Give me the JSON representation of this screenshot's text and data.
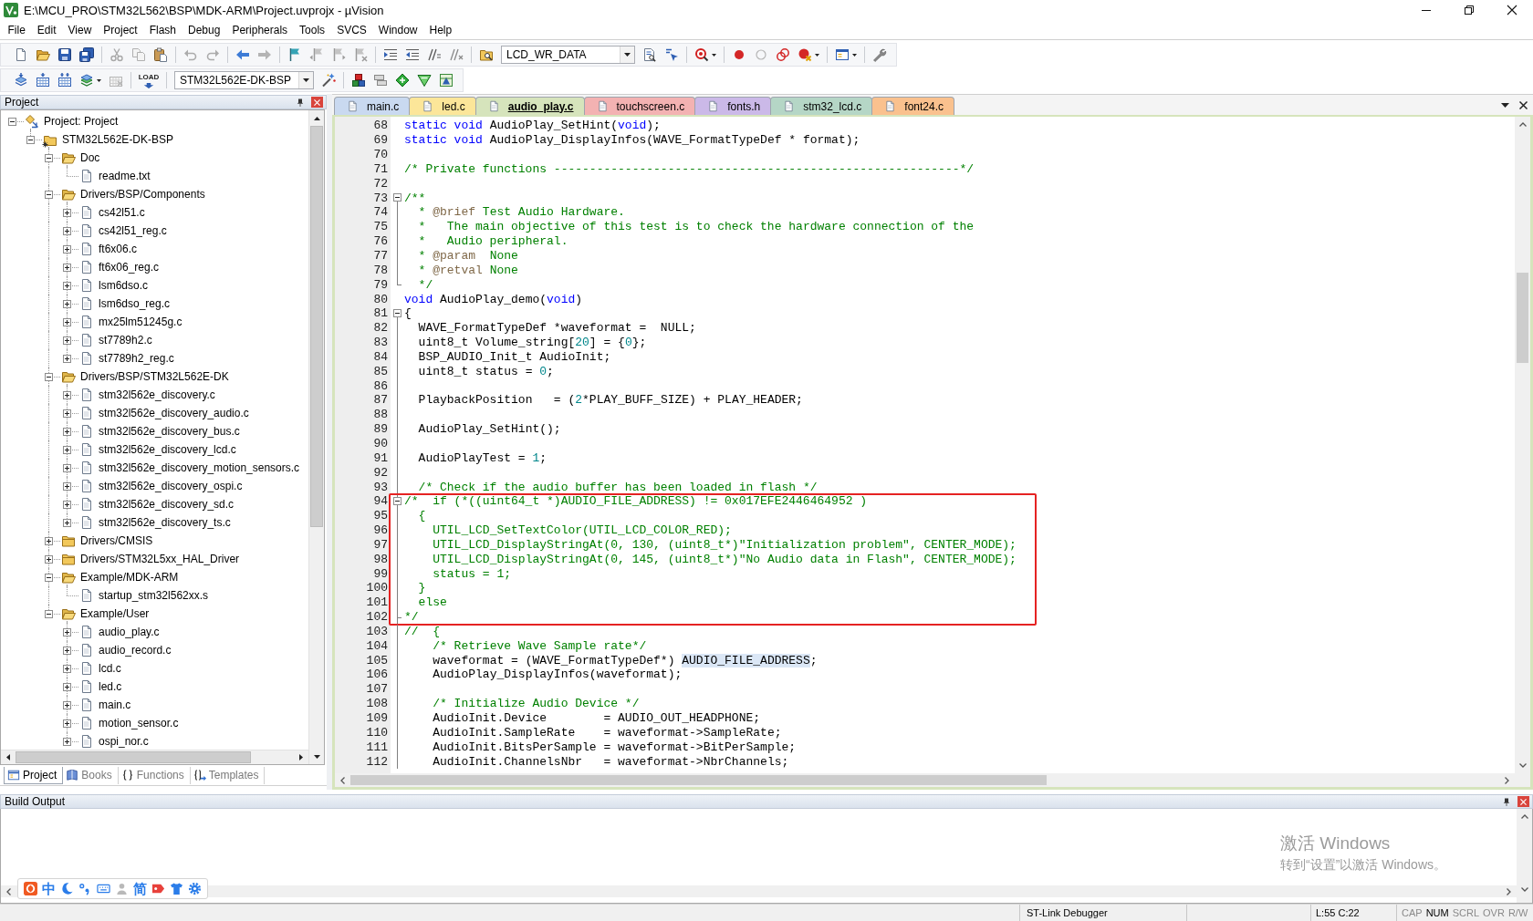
{
  "window": {
    "title": "E:\\MCU_PRO\\STM32L562\\BSP\\MDK-ARM\\Project.uvprojx - µVision"
  },
  "menu": [
    "File",
    "Edit",
    "View",
    "Project",
    "Flash",
    "Debug",
    "Peripherals",
    "Tools",
    "SVCS",
    "Window",
    "Help"
  ],
  "toolbar": {
    "find_text": "LCD_WR_DATA",
    "load_caption": "LOAD",
    "target": "STM32L562E-DK-BSP"
  },
  "project_panel": {
    "title": "Project",
    "tree": [
      {
        "label": "Project: Project",
        "kind": "project",
        "expanded": true,
        "children": [
          {
            "label": "STM32L562E-DK-BSP",
            "kind": "target",
            "expanded": true,
            "children": [
              {
                "label": "Doc",
                "kind": "group",
                "expanded": true,
                "children": [
                  {
                    "label": "readme.txt",
                    "kind": "file"
                  }
                ]
              },
              {
                "label": "Drivers/BSP/Components",
                "kind": "group",
                "expanded": true,
                "children": [
                  {
                    "label": "cs42l51.c",
                    "kind": "file",
                    "expanded": false
                  },
                  {
                    "label": "cs42l51_reg.c",
                    "kind": "file",
                    "expanded": false
                  },
                  {
                    "label": "ft6x06.c",
                    "kind": "file",
                    "expanded": false
                  },
                  {
                    "label": "ft6x06_reg.c",
                    "kind": "file",
                    "expanded": false
                  },
                  {
                    "label": "lsm6dso.c",
                    "kind": "file",
                    "expanded": false
                  },
                  {
                    "label": "lsm6dso_reg.c",
                    "kind": "file",
                    "expanded": false
                  },
                  {
                    "label": "mx25lm51245g.c",
                    "kind": "file",
                    "expanded": false
                  },
                  {
                    "label": "st7789h2.c",
                    "kind": "file",
                    "expanded": false
                  },
                  {
                    "label": "st7789h2_reg.c",
                    "kind": "file",
                    "expanded": false
                  }
                ]
              },
              {
                "label": "Drivers/BSP/STM32L562E-DK",
                "kind": "group",
                "expanded": true,
                "children": [
                  {
                    "label": "stm32l562e_discovery.c",
                    "kind": "file",
                    "expanded": false
                  },
                  {
                    "label": "stm32l562e_discovery_audio.c",
                    "kind": "file",
                    "expanded": false
                  },
                  {
                    "label": "stm32l562e_discovery_bus.c",
                    "kind": "file",
                    "expanded": false
                  },
                  {
                    "label": "stm32l562e_discovery_lcd.c",
                    "kind": "file",
                    "expanded": false
                  },
                  {
                    "label": "stm32l562e_discovery_motion_sensors.c",
                    "kind": "file",
                    "expanded": false
                  },
                  {
                    "label": "stm32l562e_discovery_ospi.c",
                    "kind": "file",
                    "expanded": false
                  },
                  {
                    "label": "stm32l562e_discovery_sd.c",
                    "kind": "file",
                    "expanded": false
                  },
                  {
                    "label": "stm32l562e_discovery_ts.c",
                    "kind": "file",
                    "expanded": false
                  }
                ]
              },
              {
                "label": "Drivers/CMSIS",
                "kind": "group",
                "expanded": false
              },
              {
                "label": "Drivers/STM32L5xx_HAL_Driver",
                "kind": "group",
                "expanded": false
              },
              {
                "label": "Example/MDK-ARM",
                "kind": "group",
                "expanded": true,
                "children": [
                  {
                    "label": "startup_stm32l562xx.s",
                    "kind": "file"
                  }
                ]
              },
              {
                "label": "Example/User",
                "kind": "group",
                "expanded": true,
                "children": [
                  {
                    "label": "audio_play.c",
                    "kind": "file",
                    "expanded": false
                  },
                  {
                    "label": "audio_record.c",
                    "kind": "file",
                    "expanded": false
                  },
                  {
                    "label": "lcd.c",
                    "kind": "file",
                    "expanded": false
                  },
                  {
                    "label": "led.c",
                    "kind": "file",
                    "expanded": false
                  },
                  {
                    "label": "main.c",
                    "kind": "file",
                    "expanded": false
                  },
                  {
                    "label": "motion_sensor.c",
                    "kind": "file",
                    "expanded": false
                  },
                  {
                    "label": "ospi_nor.c",
                    "kind": "file",
                    "expanded": false
                  }
                ]
              }
            ]
          }
        ]
      }
    ],
    "tabs": [
      {
        "label": "Project",
        "selected": true
      },
      {
        "label": "Books",
        "selected": false
      },
      {
        "label": "Functions",
        "selected": false
      },
      {
        "label": "Templates",
        "selected": false
      }
    ]
  },
  "editor": {
    "tabs": [
      {
        "label": "main.c",
        "color": "#c9d9f0",
        "selected": false
      },
      {
        "label": "led.c",
        "color": "#fce699",
        "selected": false
      },
      {
        "label": "audio_play.c",
        "color": "#d6e4bc",
        "selected": true
      },
      {
        "label": "touchscreen.c",
        "color": "#f3b2b2",
        "selected": false
      },
      {
        "label": "fonts.h",
        "color": "#cbb9e8",
        "selected": false
      },
      {
        "label": "stm32_lcd.c",
        "color": "#b5d6c6",
        "selected": false
      },
      {
        "label": "font24.c",
        "color": "#fac18e",
        "selected": false
      }
    ],
    "blocks": [
      {
        "boxed": false,
        "lines": [
          {
            "number": "68",
            "kind": "plain",
            "code": [
              {
                "kind": "keyword",
                "text": "static void"
              },
              {
                "kind": "plain",
                "text": " AudioPlay_SetHint("
              },
              {
                "kind": "keyword",
                "text": "void"
              },
              {
                "kind": "plain",
                "text": ");"
              }
            ]
          },
          {
            "number": "69",
            "kind": "plain",
            "code": [
              {
                "kind": "keyword",
                "text": "static void"
              },
              {
                "kind": "plain",
                "text": " AudioPlay_DisplayInfos(WAVE_FormatTypeDef * format);"
              }
            ]
          },
          {
            "number": "70",
            "kind": "plain"
          },
          {
            "number": "71",
            "kind": "plain",
            "code": [
              {
                "kind": "comment",
                "text": "/* Private functions ---------------------------------------------------------*/"
              }
            ]
          },
          {
            "number": "72",
            "kind": "plain"
          },
          {
            "number": "73",
            "kind": "fold_start",
            "code": [
              {
                "kind": "comment",
                "text": "/**"
              }
            ]
          },
          {
            "number": "74",
            "kind": "fold_body",
            "code": [
              {
                "kind": "comment",
                "text": "  * "
              },
              {
                "kind": "doctag",
                "text": "@brief"
              },
              {
                "kind": "comment",
                "text": " Test Audio Hardware."
              }
            ]
          },
          {
            "number": "75",
            "kind": "fold_body",
            "code": [
              {
                "kind": "comment",
                "text": "  *   The main objective of this test is to check the hardware connection of the"
              }
            ]
          },
          {
            "number": "76",
            "kind": "fold_body",
            "code": [
              {
                "kind": "comment",
                "text": "  *   Audio peripheral."
              }
            ]
          },
          {
            "number": "77",
            "kind": "fold_body",
            "code": [
              {
                "kind": "comment",
                "text": "  * "
              },
              {
                "kind": "doctag",
                "text": "@param"
              },
              {
                "kind": "comment",
                "text": "  None"
              }
            ]
          },
          {
            "number": "78",
            "kind": "fold_body",
            "code": [
              {
                "kind": "comment",
                "text": "  * "
              },
              {
                "kind": "doctag",
                "text": "@retval"
              },
              {
                "kind": "comment",
                "text": " None"
              }
            ]
          },
          {
            "number": "79",
            "kind": "fold_end",
            "code": [
              {
                "kind": "comment",
                "text": "  */"
              }
            ]
          },
          {
            "number": "80",
            "kind": "plain",
            "code": [
              {
                "kind": "keyword",
                "text": "void"
              },
              {
                "kind": "plain",
                "text": " AudioPlay_demo("
              },
              {
                "kind": "keyword",
                "text": "void"
              },
              {
                "kind": "plain",
                "text": ")"
              }
            ]
          },
          {
            "number": "81",
            "kind": "fold_start",
            "code": [
              {
                "kind": "plain",
                "text": "{"
              }
            ]
          },
          {
            "number": "82",
            "kind": "fold_body",
            "code": [
              {
                "kind": "plain",
                "text": "  WAVE_FormatTypeDef *waveformat =  NULL;"
              }
            ]
          },
          {
            "number": "83",
            "kind": "fold_body",
            "code": [
              {
                "kind": "plain",
                "text": "  uint8_t Volume_string["
              },
              {
                "kind": "number",
                "text": "20"
              },
              {
                "kind": "plain",
                "text": "] = {"
              },
              {
                "kind": "number",
                "text": "0"
              },
              {
                "kind": "plain",
                "text": "};"
              }
            ]
          },
          {
            "number": "84",
            "kind": "fold_body",
            "code": [
              {
                "kind": "plain",
                "text": "  BSP_AUDIO_Init_t AudioInit;"
              }
            ]
          },
          {
            "number": "85",
            "kind": "fold_body",
            "code": [
              {
                "kind": "plain",
                "text": "  uint8_t status = "
              },
              {
                "kind": "number",
                "text": "0"
              },
              {
                "kind": "plain",
                "text": ";"
              }
            ]
          },
          {
            "number": "86",
            "kind": "fold_body"
          },
          {
            "number": "87",
            "kind": "fold_body",
            "code": [
              {
                "kind": "plain",
                "text": "  PlaybackPosition   = ("
              },
              {
                "kind": "number",
                "text": "2"
              },
              {
                "kind": "plain",
                "text": "*PLAY_BUFF_SIZE) + PLAY_HEADER;"
              }
            ]
          },
          {
            "number": "88",
            "kind": "fold_body"
          },
          {
            "number": "89",
            "kind": "fold_body",
            "code": [
              {
                "kind": "plain",
                "text": "  AudioPlay_SetHint();"
              }
            ]
          },
          {
            "number": "90",
            "kind": "fold_body"
          },
          {
            "number": "91",
            "kind": "fold_body",
            "code": [
              {
                "kind": "plain",
                "text": "  AudioPlayTest = "
              },
              {
                "kind": "number",
                "text": "1"
              },
              {
                "kind": "plain",
                "text": ";"
              }
            ]
          },
          {
            "number": "92",
            "kind": "fold_body"
          },
          {
            "number": "93",
            "kind": "fold_body",
            "code": [
              {
                "kind": "comment",
                "text": "  /* Check if the audio buffer has been loaded in flash */"
              }
            ]
          }
        ]
      },
      {
        "boxed": true,
        "lines": [
          {
            "number": "94",
            "kind": "fold_start",
            "code": [
              {
                "kind": "comment",
                "text": "/*  if (*((uint64_t *)AUDIO_FILE_ADDRESS) != 0x017EFE2446464952 )"
              }
            ]
          },
          {
            "number": "95",
            "kind": "fold_body",
            "code": [
              {
                "kind": "comment",
                "text": "  {"
              }
            ]
          },
          {
            "number": "96",
            "kind": "fold_body",
            "code": [
              {
                "kind": "comment",
                "text": "    UTIL_LCD_SetTextColor(UTIL_LCD_COLOR_RED);"
              }
            ]
          },
          {
            "number": "97",
            "kind": "fold_body",
            "code": [
              {
                "kind": "comment",
                "text": "    UTIL_LCD_DisplayStringAt(0, 130, (uint8_t*)\"Initialization problem\", CENTER_MODE);"
              }
            ]
          },
          {
            "number": "98",
            "kind": "fold_body",
            "code": [
              {
                "kind": "comment",
                "text": "    UTIL_LCD_DisplayStringAt(0, 145, (uint8_t*)\"No Audio data in Flash\", CENTER_MODE);"
              }
            ]
          },
          {
            "number": "99",
            "kind": "fold_body",
            "code": [
              {
                "kind": "comment",
                "text": "    status = 1;"
              }
            ]
          },
          {
            "number": "100",
            "kind": "fold_body",
            "code": [
              {
                "kind": "comment",
                "text": "  }"
              }
            ]
          },
          {
            "number": "101",
            "kind": "fold_body",
            "code": [
              {
                "kind": "comment",
                "text": "  else"
              }
            ]
          },
          {
            "number": "102",
            "kind": "fold_end",
            "code": [
              {
                "kind": "comment",
                "text": "*/"
              }
            ]
          }
        ]
      },
      {
        "boxed": false,
        "lines": [
          {
            "number": "103",
            "kind": "fold_body",
            "code": [
              {
                "kind": "comment",
                "text": "//  {"
              }
            ]
          },
          {
            "number": "104",
            "kind": "fold_body",
            "code": [
              {
                "kind": "comment",
                "text": "    /* Retrieve Wave Sample rate*/"
              }
            ]
          },
          {
            "number": "105",
            "kind": "fold_body",
            "code": [
              {
                "kind": "plain",
                "text": "    waveformat = (WAVE_FormatTypeDef*) "
              },
              {
                "kind": "highlight",
                "text": "AUDIO_FILE_ADDRESS"
              },
              {
                "kind": "plain",
                "text": ";"
              }
            ]
          },
          {
            "number": "106",
            "kind": "fold_body",
            "code": [
              {
                "kind": "plain",
                "text": "    AudioPlay_DisplayInfos(waveformat);"
              }
            ]
          },
          {
            "number": "107",
            "kind": "fold_body"
          },
          {
            "number": "108",
            "kind": "fold_body",
            "code": [
              {
                "kind": "comment",
                "text": "    /* Initialize Audio Device */"
              }
            ]
          },
          {
            "number": "109",
            "kind": "fold_body",
            "code": [
              {
                "kind": "plain",
                "text": "    AudioInit.Device        = AUDIO_OUT_HEADPHONE;"
              }
            ]
          },
          {
            "number": "110",
            "kind": "fold_body",
            "code": [
              {
                "kind": "plain",
                "text": "    AudioInit.SampleRate    = waveformat->SampleRate;"
              }
            ]
          },
          {
            "number": "111",
            "kind": "fold_body",
            "code": [
              {
                "kind": "plain",
                "text": "    AudioInit.BitsPerSample = waveformat->BitPerSample;"
              }
            ]
          },
          {
            "number": "112",
            "kind": "fold_body",
            "code": [
              {
                "kind": "plain",
                "text": "    AudioInit.ChannelsNbr   = waveformat->NbrChannels;"
              }
            ]
          }
        ]
      }
    ]
  },
  "build_output": {
    "title": "Build Output"
  },
  "ime_toolbar": {
    "input_mode": "中",
    "script": "简"
  },
  "activation_notice": {
    "title": "激活 Windows",
    "text": "转到“设置”以激活 Windows。"
  },
  "status_bar": {
    "debugger": "ST-Link Debugger",
    "cursor": "L:55 C:22",
    "indicators": [
      {
        "label": "CAP",
        "on": false
      },
      {
        "label": "NUM",
        "on": true
      },
      {
        "label": "SCRL",
        "on": false
      },
      {
        "label": "OVR",
        "on": false
      },
      {
        "label": "R/W",
        "on": false
      }
    ]
  }
}
